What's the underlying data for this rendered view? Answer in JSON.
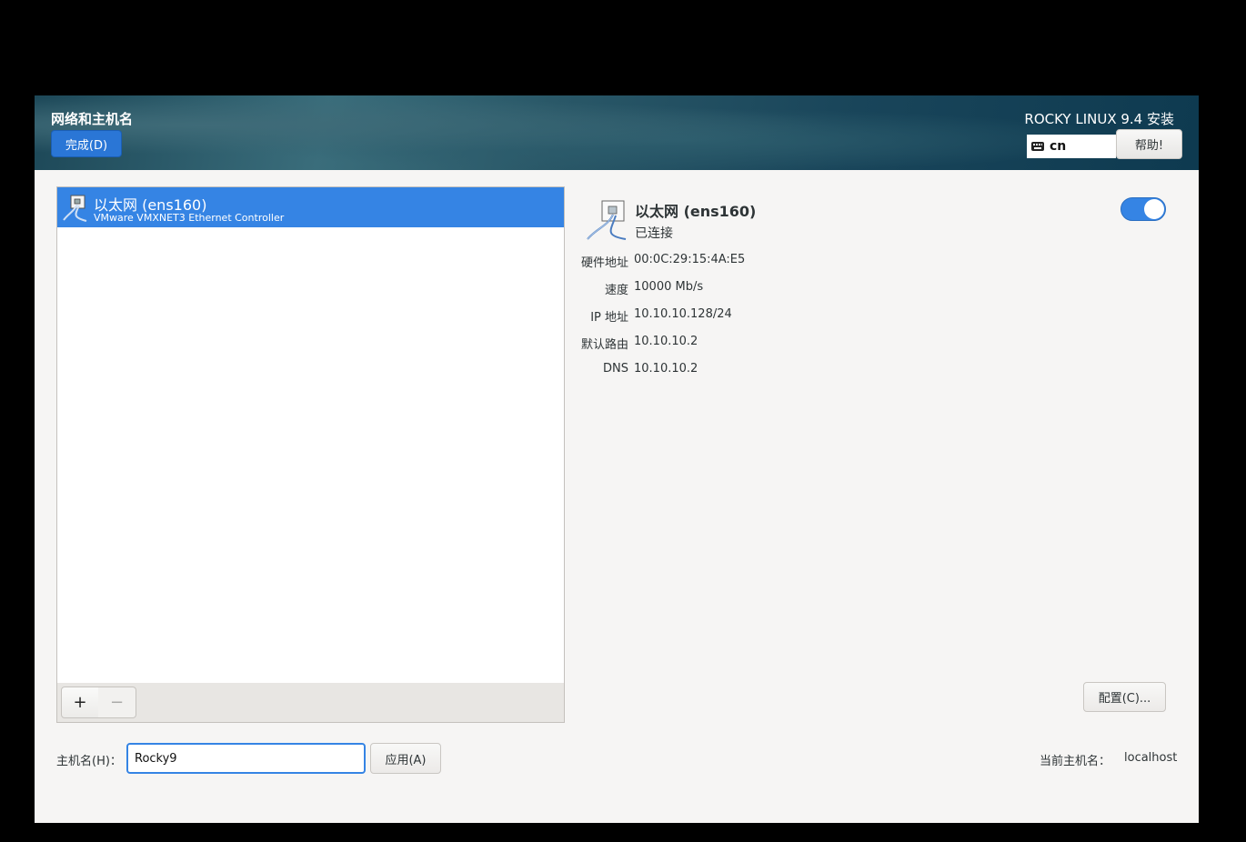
{
  "header": {
    "title": "网络和主机名",
    "done_label": "完成(D)",
    "product": "ROCKY LINUX 9.4 安装",
    "keyboard_layout": "cn",
    "help_label": "帮助!"
  },
  "devices": [
    {
      "name": "以太网 (ens160)",
      "description": "VMware VMXNET3 Ethernet Controller",
      "selected": true
    }
  ],
  "list_toolbar": {
    "add_label": "+",
    "remove_label": "−"
  },
  "details": {
    "name": "以太网 (ens160)",
    "status": "已连接",
    "enabled": true,
    "properties": [
      {
        "label": "硬件地址",
        "value": "00:0C:29:15:4A:E5"
      },
      {
        "label": "速度",
        "value": "10000 Mb/s"
      },
      {
        "label": "IP 地址",
        "value": "10.10.10.128/24"
      },
      {
        "label": "默认路由",
        "value": "10.10.10.2"
      },
      {
        "label": "DNS",
        "value": "10.10.10.2"
      }
    ],
    "configure_label": "配置(C)..."
  },
  "hostname": {
    "label": "主机名(H)：",
    "value": "Rocky9",
    "apply_label": "应用(A)",
    "current_label": "当前主机名：",
    "current_value": "localhost"
  },
  "colors": {
    "accent": "#3584e4",
    "header_dark": "#0e3a50"
  }
}
